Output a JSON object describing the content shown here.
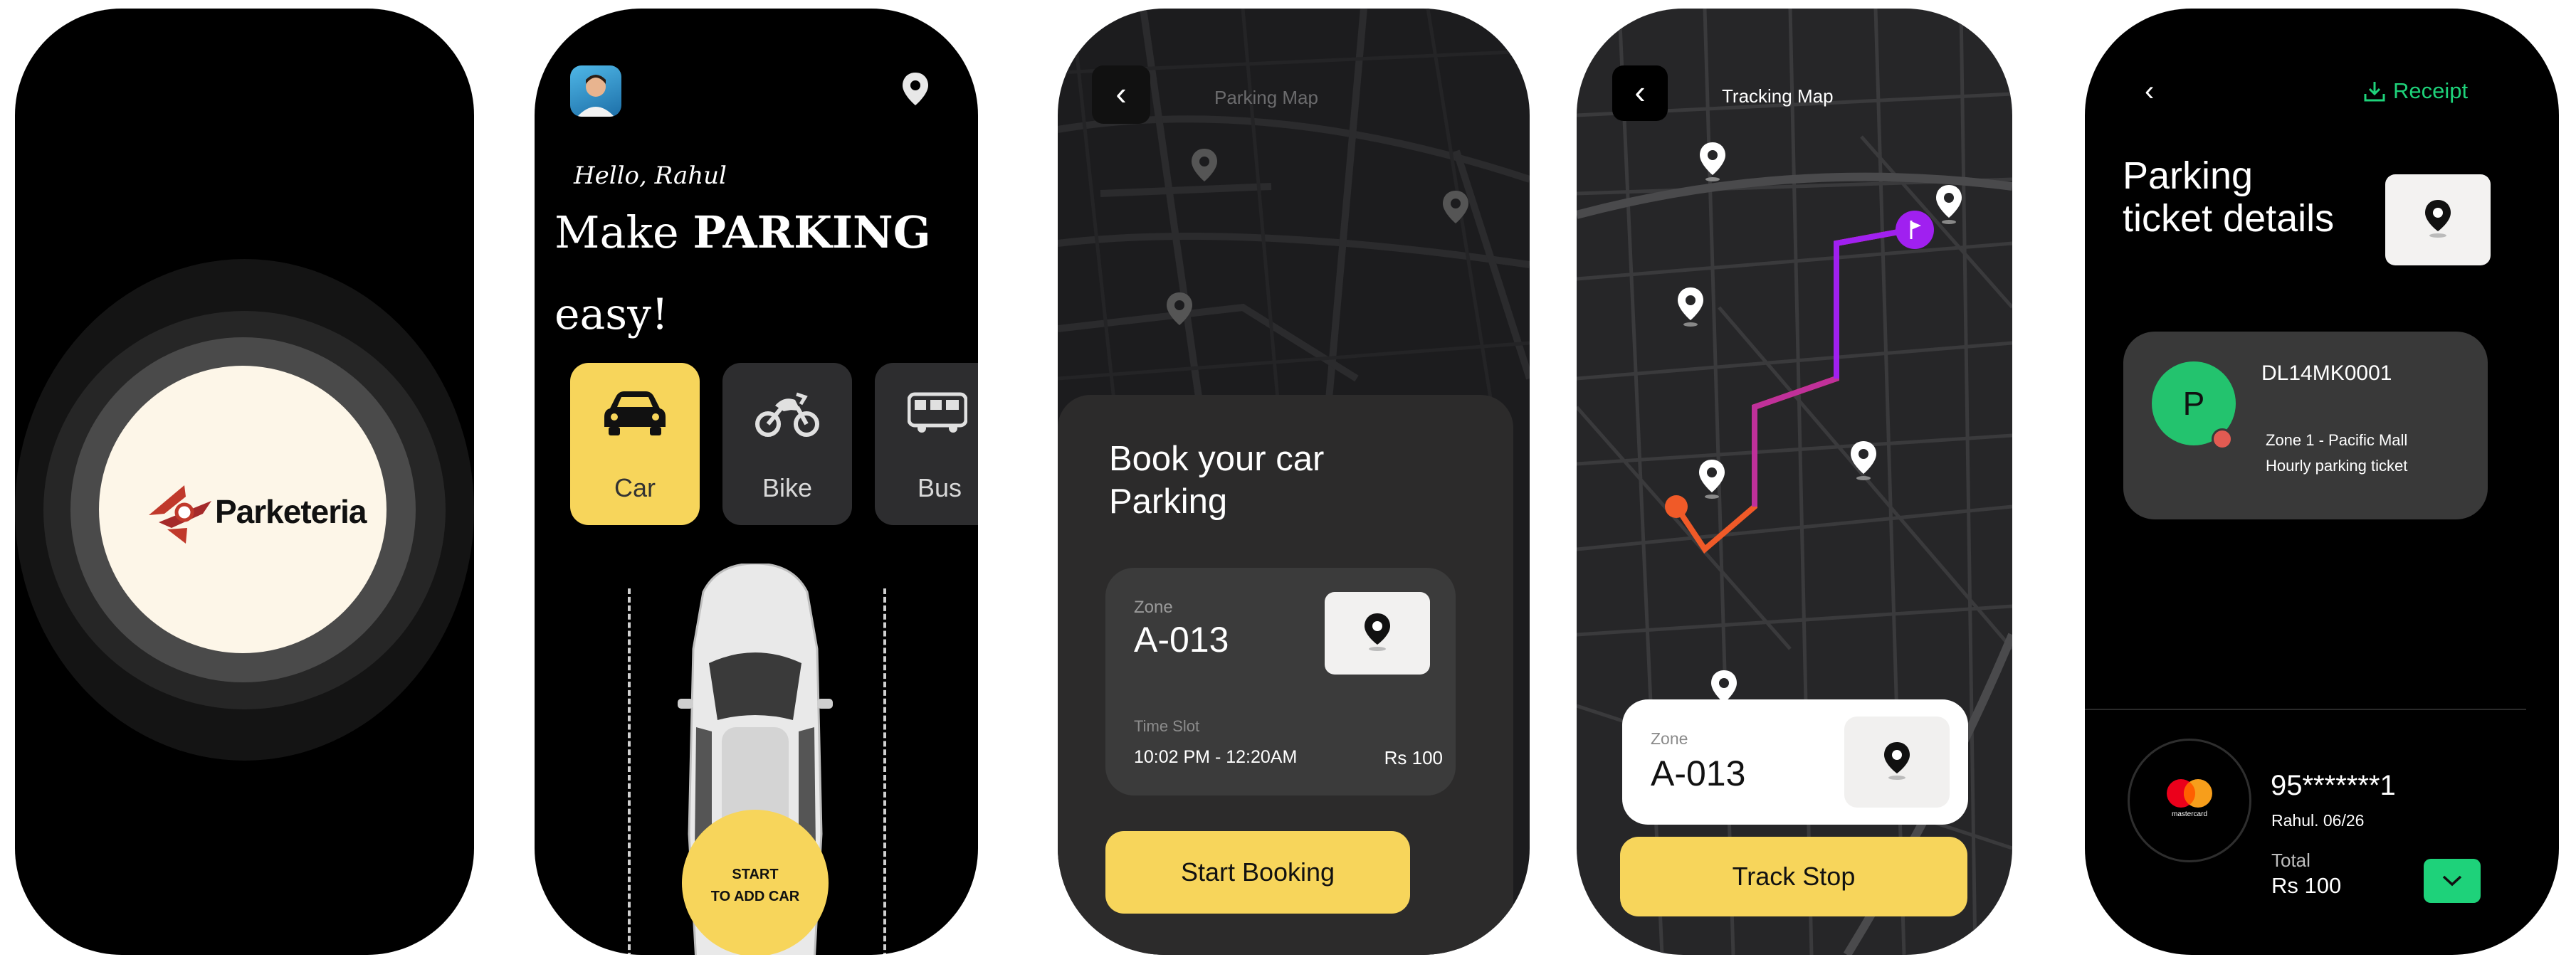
{
  "splash": {
    "brand": "Parketeria"
  },
  "home": {
    "greeting": "Hello, Rahul",
    "headline_regular": "Make ",
    "headline_bold": "PARKING",
    "headline_line2": "easy!",
    "vehicles": [
      {
        "label": "Car",
        "icon": "car-icon",
        "selected": true
      },
      {
        "label": "Bike",
        "icon": "motorbike-icon",
        "selected": false
      },
      {
        "label": "Bus",
        "icon": "bus-icon",
        "selected": false
      }
    ],
    "start_button": {
      "line1": "START",
      "line2": "TO ADD CAR"
    }
  },
  "parking_map": {
    "title": "Parking Map",
    "sheet_title": "Book your car Parking",
    "zone_label": "Zone",
    "zone": "A-013",
    "time_slot_label": "Time Slot",
    "time_slot": "10:02 PM - 12:20AM",
    "price": "Rs 100",
    "button": "Start Booking"
  },
  "tracking_map": {
    "title": "Tracking Map",
    "zone_label": "Zone",
    "zone": "A-013",
    "button": "Track Stop",
    "colors": {
      "route_start": "#f05a28",
      "route_end": "#a020f0"
    }
  },
  "ticket": {
    "receipt_label": "Receipt",
    "title": "Parking ticket details",
    "avatar_letter": "P",
    "plate": "DL14MK0001",
    "zone_line": "Zone 1 - Pacific Mall",
    "ticket_type": "Hourly parking ticket",
    "card_number": "95*******1",
    "card_holder": "Rahul. 06/26",
    "card_brand": "mastercard",
    "total_label": "Total",
    "total_value": "Rs 100"
  },
  "colors": {
    "accent_yellow": "#f7d55b",
    "accent_green": "#1ed27a"
  }
}
